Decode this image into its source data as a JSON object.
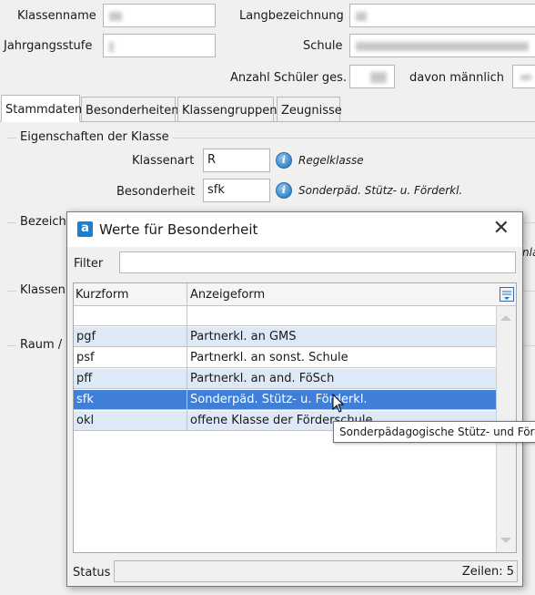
{
  "form": {
    "klassenname_label": "Klassenname",
    "langbezeichnung_label": "Langbezeichnung",
    "jahrgangsstufe_label": "Jahrgangsstufe",
    "schule_label": "Schule",
    "anzahl_label": "Anzahl Schüler ges.",
    "maennlich_label": "davon männlich"
  },
  "tabs": [
    {
      "label": "Stammdaten"
    },
    {
      "label": "Besonderheiten"
    },
    {
      "label": "Klassengruppen"
    },
    {
      "label": "Zeugnisse"
    }
  ],
  "stammdaten": {
    "group_eigenschaften": "Eigenschaften der Klasse",
    "klassenart_label": "Klassenart",
    "klassenart_value": "R",
    "klassenart_hint": "Regelklasse",
    "besonderheit_label": "Besonderheit",
    "besonderheit_value": "sfk",
    "besonderheit_hint": "Sonderpäd. Stütz- u. Förderkl.",
    "group_bezeichnung": "Bezeichn",
    "group_klassenleitung": "Klassenle",
    "group_raum": "Raum / C",
    "right_edge_text": "nla"
  },
  "dialog": {
    "title": "Werte für Besonderheit",
    "filter_label": "Filter",
    "filter_value": "",
    "columns": [
      "Kurzform",
      "Anzeigeform"
    ],
    "rows": [
      {
        "kurz": "pgf",
        "anzeige": "Partnerkl. an GMS"
      },
      {
        "kurz": "psf",
        "anzeige": "Partnerkl. an sonst. Schule"
      },
      {
        "kurz": "pff",
        "anzeige": "Partnerkl. an and. FöSch"
      },
      {
        "kurz": "sfk",
        "anzeige": "Sonderpäd. Stütz- u. Förderkl."
      },
      {
        "kurz": "okl",
        "anzeige": "offene Klasse der Förderschule"
      }
    ],
    "selected_index": 3,
    "status_label": "Status",
    "zeilen_text": "Zeilen: 5"
  },
  "tooltip": {
    "text": "Sonderpädagogische Stütz- und Förderklasse"
  },
  "colors": {
    "selection": "#3f7fd8",
    "alt_row": "#dde9f7",
    "app_icon": "#1a7fd0"
  }
}
